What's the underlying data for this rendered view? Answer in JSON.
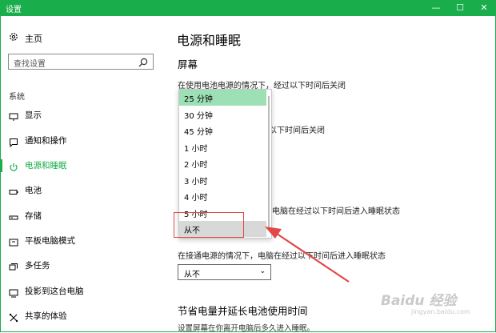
{
  "window": {
    "title": "设置",
    "minimize": "—",
    "maximize": "☐",
    "close": "✕"
  },
  "sidebar": {
    "home_label": "主页",
    "search_placeholder": "查找设置",
    "section": "系统",
    "items": [
      {
        "label": "显示",
        "icon": "monitor-icon"
      },
      {
        "label": "通知和操作",
        "icon": "notification-icon"
      },
      {
        "label": "电源和睡眠",
        "icon": "power-icon",
        "active": true
      },
      {
        "label": "电池",
        "icon": "battery-icon"
      },
      {
        "label": "存储",
        "icon": "storage-icon"
      },
      {
        "label": "平板电脑模式",
        "icon": "tablet-icon"
      },
      {
        "label": "多任务",
        "icon": "multitask-icon"
      },
      {
        "label": "投影到这台电脑",
        "icon": "project-icon"
      },
      {
        "label": "共享的体验",
        "icon": "share-icon"
      }
    ]
  },
  "main": {
    "title": "电源和睡眠",
    "screen_heading": "屏幕",
    "screen_battery_desc": "在使用电池电源的情况下，经过以下时间后关闭",
    "screen_plugged_desc": "以下时间后关闭",
    "sleep_battery_desc": "电脑在经过以下时间后进入睡眠状态",
    "sleep_plugged_desc": "在接通电源的情况下，电脑在经过以下时间后进入睡眠状态",
    "sleep_plugged_value": "从不",
    "save_heading": "节省电量并延长电池使用时间",
    "save_desc": "设置屏幕在你离开电脑后多久进入睡眠。"
  },
  "dropdown": {
    "options": [
      "25 分钟",
      "30 分钟",
      "45 分钟",
      "1 小时",
      "2 小时",
      "3 小时",
      "4 小时",
      "5 小时",
      "从不"
    ],
    "selected_index": 0,
    "hover_index": 8
  },
  "colors": {
    "accent": "#1aad4b",
    "annotation": "#e24848"
  },
  "watermark": {
    "brand": "Baidu 经验",
    "url": "jingyan.baidu.com"
  }
}
